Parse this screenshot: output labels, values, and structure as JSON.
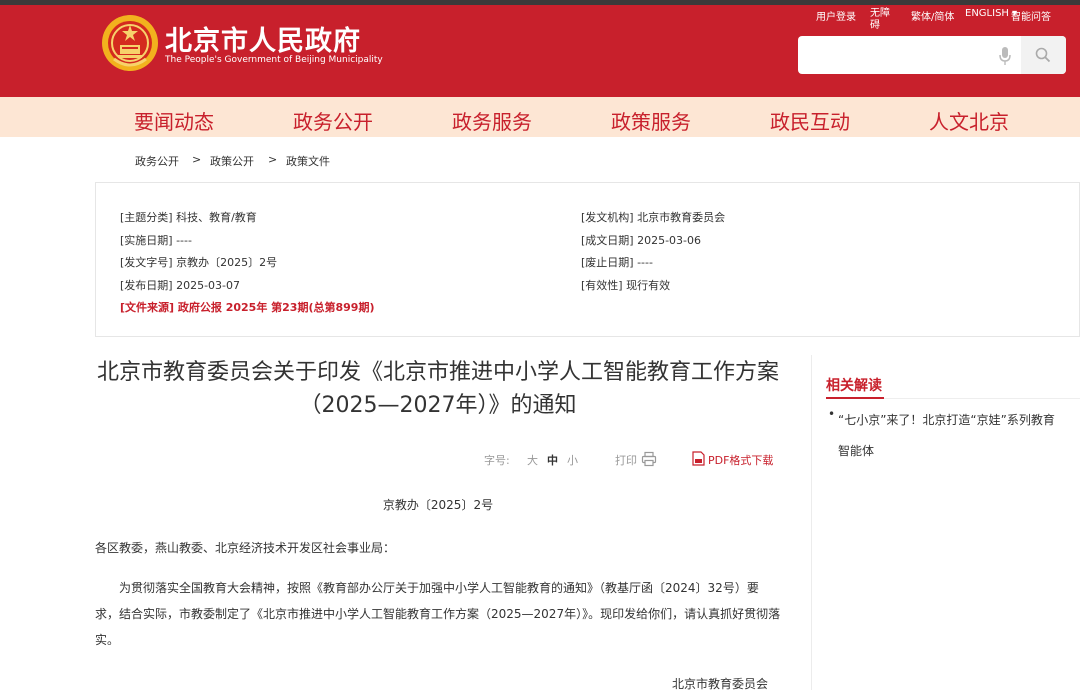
{
  "header": {
    "site_title": "北京市人民政府",
    "site_subtitle": "The People's Government of Beijing Municipality",
    "emblem_icon": "national-emblem-icon",
    "brand_color": "#c8202c",
    "top_links": {
      "login": "用户登录",
      "barrier_free": "无障碍",
      "trad_simp": "繁体/简体",
      "language": "ENGLISH ▾",
      "smart_qa": "智能问答"
    },
    "search": {
      "placeholder": "",
      "mic_icon": "microphone-icon",
      "search_icon": "search-icon"
    }
  },
  "nav": {
    "items": [
      "要闻动态",
      "政务公开",
      "政务服务",
      "政策服务",
      "政民互动",
      "人文北京"
    ],
    "background": "#fde6d4"
  },
  "breadcrumb": {
    "items": [
      "政务公开",
      "政策公开",
      "政策文件"
    ],
    "separator": ">"
  },
  "meta": {
    "topic": "[主题分类] 科技、教育/教育",
    "effective_date": "[实施日期] ----",
    "doc_number": "[发文字号] 京教办〔2025〕2号",
    "publish_date": "[发布日期] 2025-03-07",
    "source": "[文件来源] 政府公报 2025年 第23期(总第899期)",
    "issuer": "[发文机构] 北京市教育委员会",
    "created_date": "[成文日期] 2025-03-06",
    "abolish_date": "[废止日期] ----",
    "validity": "[有效性] 现行有效"
  },
  "article": {
    "title": "北京市教育委员会关于印发《北京市推进中小学人工智能教育工作方案（2025—2027年）》的通知",
    "font_size_label": "字号:",
    "font_sizes": [
      "大",
      "中",
      "小"
    ],
    "print_label": "打印",
    "pdf_label": "PDF格式下载",
    "doc_number": "京教办〔2025〕2号",
    "salutation": "各区教委，燕山教委、北京经济技术开发区社会事业局：",
    "body": "为贯彻落实全国教育大会精神，按照《教育部办公厅关于加强中小学人工智能教育的通知》（教基厅函〔2024〕32号）要求，结合实际，市教委制定了《北京市推进中小学人工智能教育工作方案（2025—2027年）》。现印发给你们，请认真抓好贯彻落实。",
    "signature": "北京市教育委员会"
  },
  "related": {
    "title": "相关解读",
    "items": [
      "“七小京”来了！北京打造“京娃”系列教育智能体"
    ]
  }
}
